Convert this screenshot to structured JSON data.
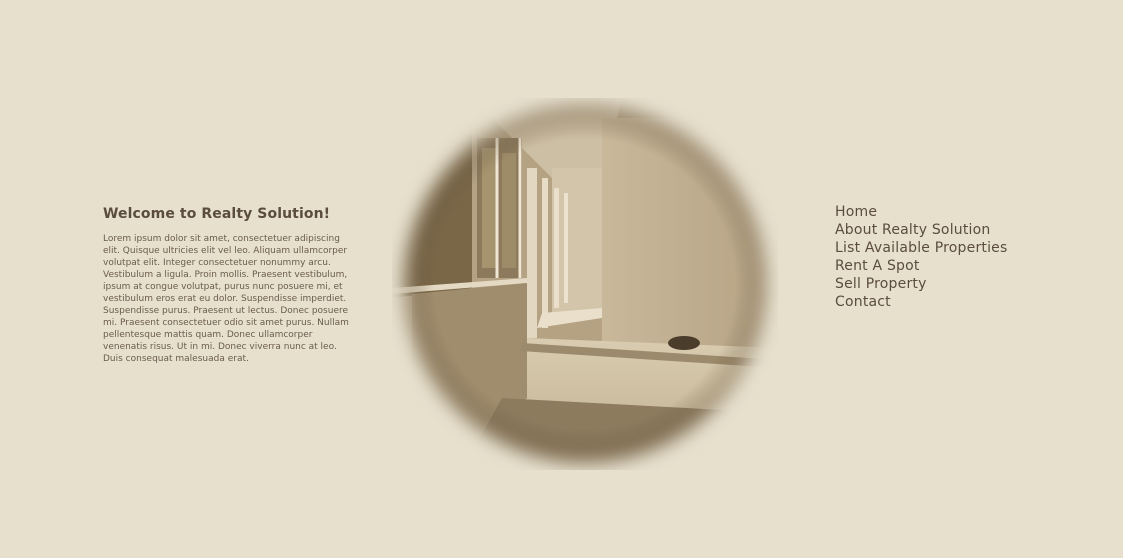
{
  "intro": {
    "heading": "Welcome to Realty Solution!",
    "body": "Lorem ipsum dolor sit amet, consectetuer adipiscing elit. Quisque ultricies elit vel leo. Aliquam ullamcorper volutpat elit. Integer consectetuer nonummy arcu. Vestibulum a ligula. Proin mollis. Praesent vestibulum, ipsum at congue volutpat, purus nunc posuere mi, et vestibulum eros erat eu dolor. Suspendisse imperdiet. Suspendisse purus. Praesent ut lectus. Donec posuere mi. Praesent consectetuer odio sit amet purus. Nullam pellentesque mattis quam. Donec ullamcorper venenatis risus. Ut in mi. Donec viverra nunc at leo. Duis consequat malesuada erat."
  },
  "nav": {
    "items": [
      {
        "label": "Home"
      },
      {
        "label": "About Realty Solution"
      },
      {
        "label": "List Available Properties"
      },
      {
        "label": "Rent A Spot"
      },
      {
        "label": "Sell Property"
      },
      {
        "label": "Contact"
      }
    ]
  },
  "theme": {
    "background": "#e7e0cd",
    "text": "#5b4d3d",
    "photo_tone": "#9a8a70"
  }
}
